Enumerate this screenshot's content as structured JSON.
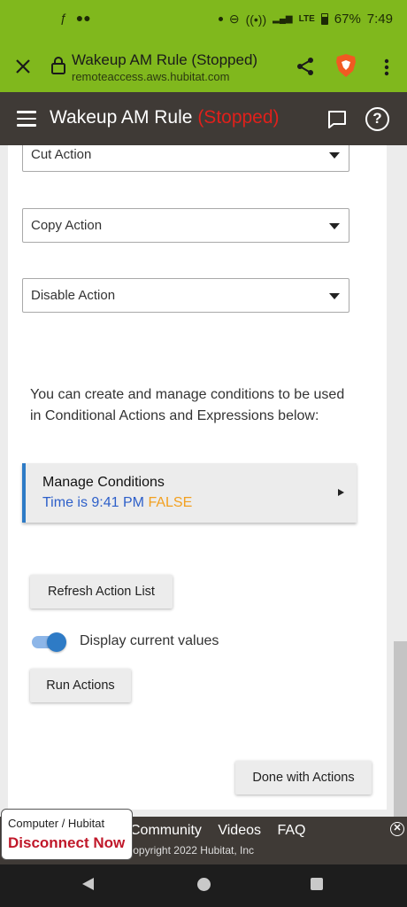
{
  "status_bar": {
    "left_icons": [
      "facebook-icon",
      "messenger-icon"
    ],
    "network": "LTE",
    "battery": "67%",
    "time": "7:49"
  },
  "browser": {
    "page_title": "Wakeup AM Rule (Stopped)",
    "host": "remoteaccess.aws.hubitat.com"
  },
  "header": {
    "title": "Wakeup AM Rule",
    "status": "(Stopped)",
    "status_color": "#e0201b"
  },
  "actions": {
    "selects": [
      {
        "label": "Cut Action"
      },
      {
        "label": "Copy Action"
      },
      {
        "label": "Disable Action"
      }
    ],
    "info_text": "You can create and manage conditions to be used in Conditional Actions and Expressions below:",
    "conditions": {
      "title": "Manage Conditions",
      "condition_text": "Time is 9:41 PM",
      "condition_result": "FALSE"
    },
    "refresh_label": "Refresh Action List",
    "toggle_label": "Display current values",
    "toggle_on": true,
    "run_label": "Run Actions",
    "done_label": "Done with Actions"
  },
  "footer": {
    "links": [
      "Community",
      "Videos",
      "FAQ"
    ],
    "copyright": "Copyright 2022 Hubitat, Inc.",
    "disconnect_sub": "Computer / Hubitat",
    "disconnect_main": "Disconnect Now"
  },
  "colors": {
    "brand_green": "#80b81d",
    "header_dark": "#3f3a36",
    "accent_blue": "#2e7bc6",
    "false_orange": "#f2a020",
    "disconnect_red": "#c0182a"
  }
}
